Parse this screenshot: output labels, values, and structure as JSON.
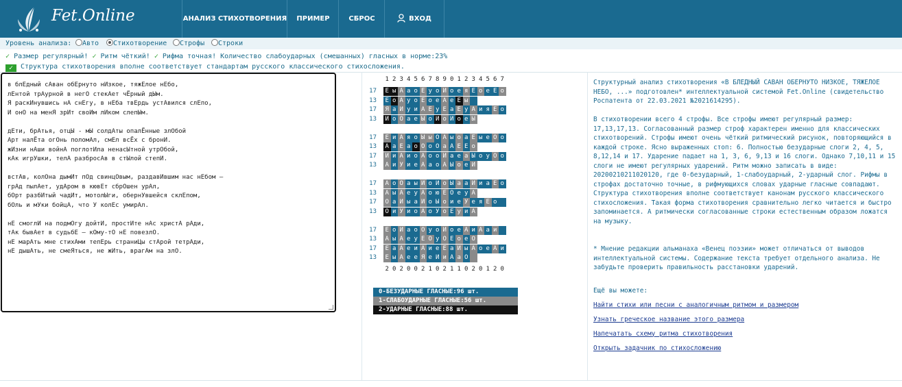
{
  "header": {
    "brand": "Fet.Online",
    "nav": [
      "АНАЛИЗ СТИХОТВОРЕНИЯ",
      "ПРИМЕР",
      "СБРОС",
      "ВХОД"
    ]
  },
  "level": {
    "label": "Уровень анализа:",
    "options": [
      "Авто",
      "Стихотворение",
      "Строфы",
      "Строки"
    ],
    "selected": "Стихотворение"
  },
  "status": {
    "s1": "Размер регулярный!",
    "s2": "Ритм чёткий!",
    "s3": "Рифма точная! Количество слабоударных (смешанных) гласных в норме:23%",
    "structure": "Структура стихотворения вполне соответствует стандартам русского классического стихосложения."
  },
  "poem": [
    "в блЕдный сАван обЕрнуто нИзкое, тяжЕлое нЕбо,",
    "лЕнтой трАурной в негО стекАет чЁрный дЫм.",
    "Я раскИнувшись нА снЕгу, в нЕба твЕрдь устАвился слЕпо,",
    "И онО на менЯ зрИт своИм лИком слепЫм.",
    "",
    "дЕти, брАтья, отцЫ - мЫ солдАты опалЁнные злОбой",
    "Арт налЁта огОнь поломАл, смЕл всЁх с бронИ.",
    "жИзни нАши войнА поглотИла ненасЫтной утрОбой,",
    "кАк игрУшки, телА разбросАв в стЫлой степИ.",
    "",
    "встАв, колОна дымИт пОд свинцОвым, раздавИвшим нас нЕбом –",
    "грАд пылАет, удАром в кювЕт сбрОшен урАл,",
    "бОрт разбИтый чадИт, мотолЫги, обернУвшейся склЕпом,",
    "бОль и мУки бойцА, что У колЕс умирАл.",
    "",
    "нЕ смоглИ на подмОгу дойтИ, простИте нАс христА рАди,",
    "тАк бывАет в судьбЕ – кОму-тО нЕ повезлО.",
    "нЕ марАть мне стихАми тепЕрь страниЦы стАрой тетрАди,",
    "нЕ дышАть, не смеЯться, не жИть, врагАм на злО."
  ],
  "scheme": {
    "header": [
      "1",
      "2",
      "3",
      "4",
      "5",
      "6",
      "7",
      "8",
      "9",
      "0",
      "1",
      "2",
      "3",
      "4",
      "5",
      "6",
      "7"
    ],
    "footer": [
      "2",
      "0",
      "2",
      "0",
      "0",
      "2",
      "1",
      "0",
      "2",
      "1",
      "1",
      "0",
      "2",
      "0",
      "1",
      "2",
      "0"
    ],
    "stanzas": [
      [
        {
          "n": "17",
          "v": "ЕыАаоЕуоИоеяЕоеЕо",
          "s": [
            2,
            2,
            1,
            0,
            0,
            1,
            0,
            0,
            1,
            0,
            0,
            1,
            0,
            1,
            0,
            0,
            1
          ]
        },
        {
          "n": "13",
          "v": "ЕоАуоЕоеАеЕы",
          "s": [
            0,
            2,
            1,
            0,
            0,
            1,
            0,
            0,
            1,
            0,
            2,
            1,
            0
          ]
        },
        {
          "n": "17",
          "v": "ЯаИуиАЕуЕаЕуАияЕо",
          "s": [
            1,
            0,
            1,
            0,
            0,
            1,
            1,
            0,
            1,
            0,
            1,
            0,
            1,
            0,
            0,
            1,
            0
          ]
        },
        {
          "n": "13",
          "v": "ИоОаеЫоИоИоеЫ",
          "s": [
            2,
            0,
            1,
            0,
            0,
            1,
            0,
            2,
            1,
            0,
            2,
            0,
            1
          ]
        }
      ],
      [
        {
          "n": "17",
          "v": "ЕиАяоЫыОАыоаЕыеОо",
          "s": [
            1,
            0,
            1,
            0,
            0,
            1,
            1,
            0,
            1,
            0,
            1,
            0,
            1,
            0,
            0,
            1,
            0
          ]
        },
        {
          "n": "13",
          "v": "АаЕаоОоОаАЕЕоИ",
          "s": [
            2,
            0,
            1,
            0,
            2,
            1,
            0,
            0,
            1,
            0,
            1,
            0,
            1
          ]
        },
        {
          "n": "17",
          "v": "ИиАиоАооИаеаЫоуОо",
          "s": [
            1,
            0,
            1,
            0,
            0,
            1,
            0,
            0,
            1,
            0,
            0,
            1,
            0,
            0,
            0,
            1,
            0
          ]
        },
        {
          "n": "13",
          "v": "АиУиеАаоАЫоеИ",
          "s": [
            1,
            0,
            1,
            0,
            0,
            1,
            0,
            0,
            1,
            0,
            1,
            0,
            1
          ]
        }
      ],
      [
        {
          "n": "17",
          "v": "АоОаыИоИоЫааИиаЕо",
          "s": [
            1,
            0,
            1,
            0,
            0,
            1,
            0,
            0,
            1,
            0,
            1,
            0,
            1,
            0,
            0,
            1,
            0
          ]
        },
        {
          "n": "13",
          "v": "АыАеуАоюЕОеуА",
          "s": [
            1,
            0,
            1,
            0,
            0,
            1,
            0,
            0,
            1,
            0,
            0,
            0,
            1
          ]
        },
        {
          "n": "17",
          "v": "ОаИыаИоЫоиеУеяЕо",
          "s": [
            1,
            0,
            1,
            0,
            0,
            1,
            0,
            0,
            1,
            0,
            0,
            1,
            0,
            0,
            1,
            0,
            0
          ]
        },
        {
          "n": "13",
          "v": "ОиУиоАоУоЕуиА",
          "s": [
            2,
            0,
            1,
            0,
            0,
            1,
            0,
            0,
            1,
            0,
            1,
            0,
            1
          ]
        }
      ],
      [
        {
          "n": "17",
          "v": "ЕоИаоОуоИоеАиАаи",
          "s": [
            1,
            0,
            1,
            0,
            0,
            1,
            0,
            0,
            1,
            0,
            0,
            1,
            0,
            1,
            0,
            1,
            0
          ]
        },
        {
          "n": "13",
          "v": "АыАеуЕОуОЕоеО",
          "s": [
            1,
            0,
            1,
            0,
            0,
            1,
            1,
            0,
            1,
            0,
            1,
            0,
            1
          ]
        },
        {
          "n": "17",
          "v": "ЕаАеиАиеЕаИыАоеАи",
          "s": [
            1,
            0,
            1,
            0,
            0,
            1,
            0,
            0,
            1,
            0,
            1,
            0,
            1,
            0,
            0,
            1,
            0
          ]
        },
        {
          "n": "13",
          "v": "ЕыАееЯеИиАаО",
          "s": [
            1,
            0,
            1,
            0,
            0,
            1,
            0,
            0,
            1,
            0,
            1,
            0,
            1
          ]
        }
      ]
    ]
  },
  "legend": {
    "l0": "0-БЕЗУДАРНЫЕ ГЛАСНЫЕ:96 шт.",
    "l1": "1-СЛАБОУДАРНЫЕ ГЛАСНЫЕ:56 шт.",
    "l2": "2-УДАРНЫЕ ГЛАСНЫЕ:88 шт."
  },
  "description": {
    "p1": "Структурный анализ стихотворения «В БЛЕДНЫЙ САВАН ОБЕРНУТО НИЗКОЕ, ТЯЖЕЛОЕ НЕБО, ...» подготовлен* интеллектуальной системой Fet.Online (свидетельство Роспатента от 22.03.2021 №2021614295).",
    "p2": "В стихотворении всего 4 строфы. Все строфы имеют регулярный размер: 17,13,17,13. Согласованный размер строф характерен именно для классических стихотворений. Строфы имеют очень чёткий ритмический рисунок, повторяющийся в каждой строке. Ясно выраженных стоп: 6. Полностью безударные слоги 2, 4, 5, 8,12,14 и 17. Ударение падает на 1, 3, 6, 9,13 и 16 слоги. Однако 7,10,11 и 15 слоги не имеют регулярных ударений. Ритм можно записать в виде: 20200210211020120, где 0-безударный, 1-слабоударный, 2-ударный слог. Рифмы в строфах достаточно точные, в рифмующихся словах ударные гласные совпадают. Структура стихотворения вполне соответствует канонам русского классического стихосложения. Такая форма стихотворения сравнительно легко читается и быстро запоминается. А ритмически согласованные строки естественным образом ложатся на музыку.",
    "p3": "* Мнение редакции альманаха «Венец поэзии» может отличаться от выводов интеллектуальной системы. Содержание текста требует отдельного анализа. Не забудьте проверить правильность расстановки ударений.",
    "more": "Ещё вы можете:",
    "links": [
      "Найти стихи или песни с аналогичным ритмом и размером",
      "Узнать греческое название этого размера",
      "Напечатать схему ритма стихотворения",
      "Открыть задачник по стихосложению"
    ]
  }
}
